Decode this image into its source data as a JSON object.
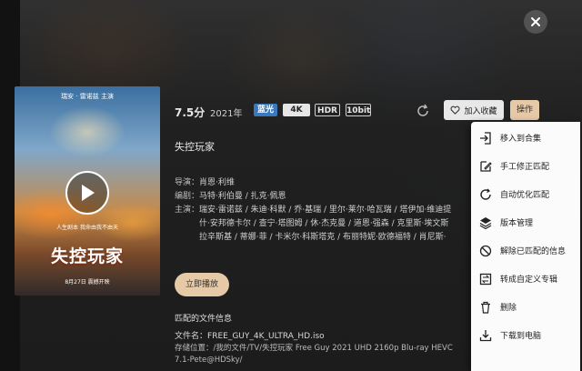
{
  "movie": {
    "rating": "7.5分",
    "year": "2021年",
    "badges": [
      "蓝光",
      "4K",
      "HDR",
      "10bit"
    ],
    "title": "失控玩家",
    "director_label": "导演：",
    "director": "肖恩·利维",
    "writer_label": "编剧：",
    "writers": "马特·利伯曼 / 扎克·佩恩",
    "cast_label": "主演：",
    "cast_lines": [
      "瑞安·雷诺兹 / 朱迪·科默 / 乔·基瑞 / 里尔·莱尔·哈瓦瑞 / 塔伊加·维迪提",
      "什·安邦德卡尔 / 查宁·塔图姆 / 休·杰克曼 / 道恩·强森 / 克里斯·埃文斯",
      "拉辛斯基 / 蒂娜·菲 / 卡米尔·科斯塔克 / 布丽特妮·欧德福特 / 肖尼斯·"
    ]
  },
  "poster": {
    "top_text": "瑞安 · 雷诺兹 主演",
    "tagline": "人生剧本  我命由我不由天",
    "title": "失控玩家",
    "date": "8月27日  震撼开映"
  },
  "buttons": {
    "favorite": "加入收藏",
    "operate": "操作",
    "play_now": "立即播放"
  },
  "files": {
    "heading": "匹配的文件信息",
    "name_label": "文件名：",
    "name": "FREE_GUY_4K_ULTRA_HD.iso",
    "path_label": "存储位置：",
    "path_line1": "/我的文件/TV/失控玩家 Free Guy 2021 UHD 2160p Blu-ray HEVC",
    "path_line2": "7.1-Pete@HDSky/"
  },
  "menu": {
    "items": [
      {
        "label": "移入到合集",
        "icon": "move-in-icon"
      },
      {
        "label": "手工修正匹配",
        "icon": "edit-icon"
      },
      {
        "label": "自动优化匹配",
        "icon": "auto-match-icon"
      },
      {
        "label": "版本管理",
        "icon": "layers-icon"
      },
      {
        "label": "解除已匹配的信息",
        "icon": "unlink-icon"
      },
      {
        "label": "转成自定义专辑",
        "icon": "convert-icon"
      },
      {
        "label": "删除",
        "icon": "delete-icon"
      },
      {
        "label": "下载到电脑",
        "icon": "download-icon"
      }
    ]
  },
  "colors": {
    "accent": "#e6c9a6",
    "bluray_badge": "#3a78c0"
  }
}
